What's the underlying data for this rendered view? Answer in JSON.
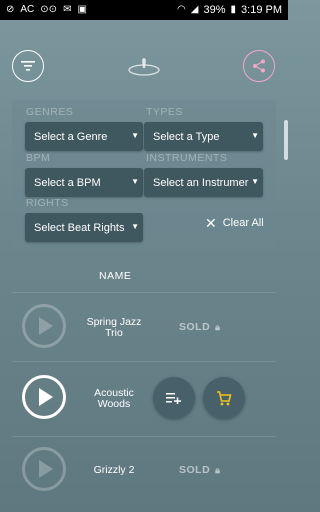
{
  "statusbar": {
    "battery": "39%",
    "time": "3:19 PM",
    "icons": [
      "blocked-icon",
      "ac-icon",
      "voicemail-icon",
      "mail-icon",
      "camera-icon",
      "wifi-icon",
      "signal-icon",
      "battery-icon"
    ]
  },
  "filters": {
    "genres_label": "GENRES",
    "genre_value": "Select a Genre",
    "types_label": "TYPES",
    "type_value": "Select a Type",
    "bpm_label": "BPM",
    "bpm_value": "Select a BPM",
    "instruments_label": "INSTRUMENTS",
    "instrument_value": "Select an Instrumer",
    "rights_label": "RIGHTS",
    "rights_value": "Select Beat Rights",
    "clear_all": "Clear All"
  },
  "list": {
    "header": "NAME",
    "tracks": [
      {
        "name": "Spring Jazz Trio",
        "status": "SOLD"
      },
      {
        "name": "Acoustic Woods",
        "status": ""
      },
      {
        "name": "Grizzly 2",
        "status": "SOLD"
      }
    ]
  },
  "colors": {
    "accent_share": "#f2a8c8",
    "cart": "#f0c419",
    "select_bg": "#3f575f"
  }
}
